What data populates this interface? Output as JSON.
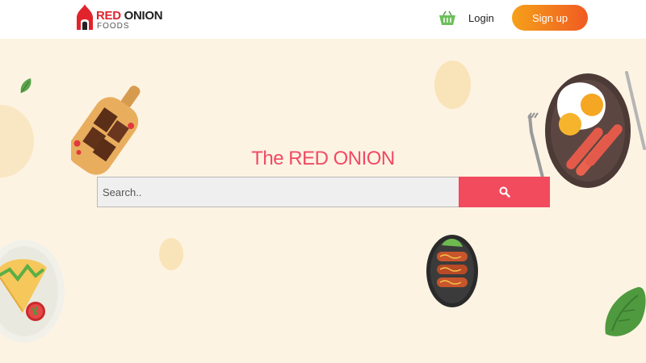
{
  "navbar": {
    "logo": {
      "title_red": "RED",
      "title_dark": "ONION",
      "subtitle": "FOODS"
    },
    "cart_icon": "cart-icon",
    "login_label": "Login",
    "signup_label": "Sign up"
  },
  "hero": {
    "title": "The RED ONION",
    "search": {
      "placeholder": "Search..",
      "value": "",
      "button_icon": "search-icon"
    }
  },
  "decorations": [
    "breakfast-plate-illustration",
    "chocolate-board-illustration",
    "taco-plate-illustration",
    "grilled-sausage-plate-illustration",
    "lettuce-illustration",
    "leaf-illustration"
  ],
  "colors": {
    "brand_red": "#e1242c",
    "accent": "#f04a63",
    "search_button": "#f14b5d",
    "signup_gradient_start": "#f5a11a",
    "signup_gradient_end": "#f05a22",
    "background": "#fdf3e3"
  }
}
